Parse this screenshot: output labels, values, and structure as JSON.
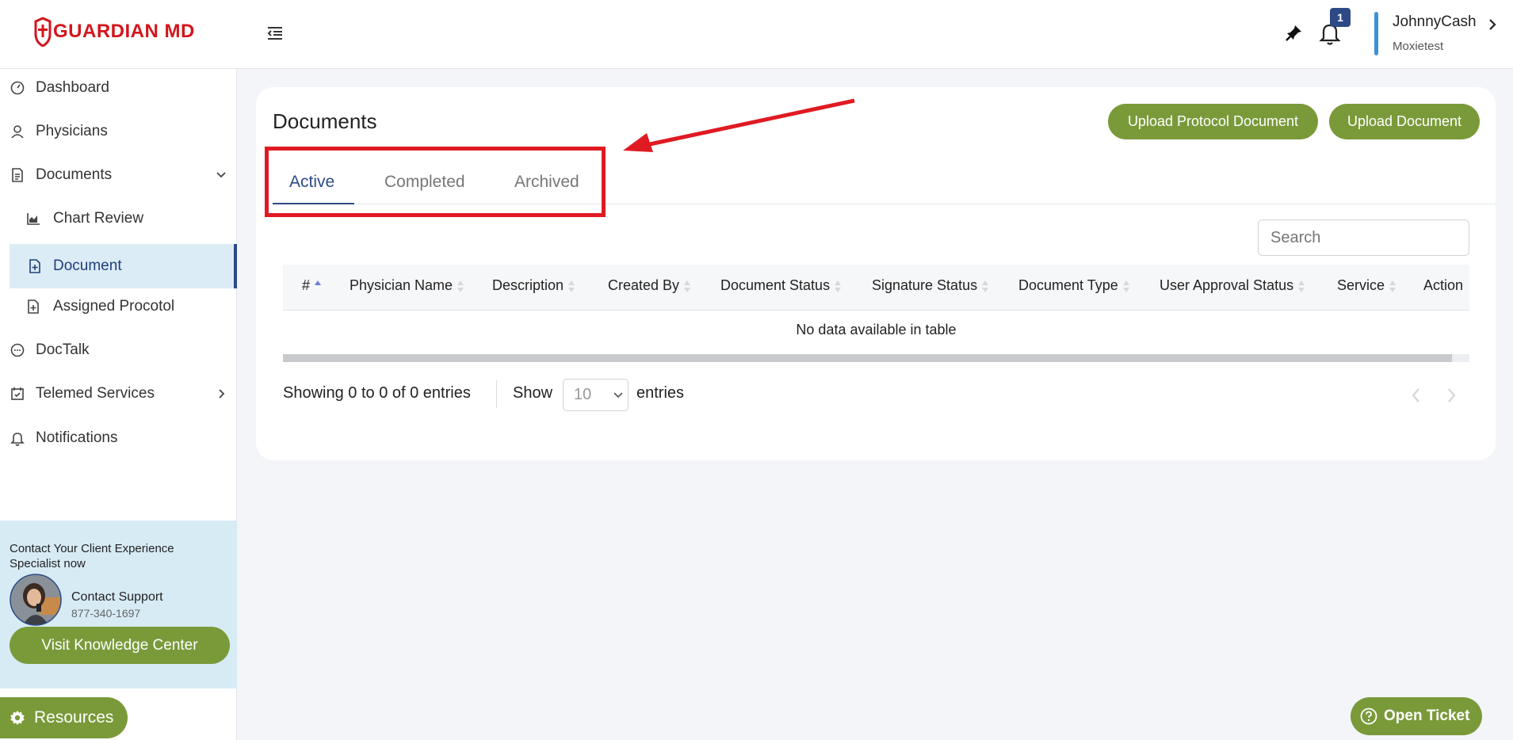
{
  "header": {
    "logo_text": "GUARDIAN MD",
    "notification_count": "1",
    "user_name": "JohnnyCash",
    "user_org": "Moxietest"
  },
  "sidebar": {
    "items": [
      {
        "label": "Dashboard",
        "icon": "dashboard-icon"
      },
      {
        "label": "Physicians",
        "icon": "user-icon"
      },
      {
        "label": "Documents",
        "icon": "document-icon"
      },
      {
        "label": "Chart Review",
        "icon": "chart-icon"
      },
      {
        "label": "Document",
        "icon": "file-plus-icon"
      },
      {
        "label": "Assigned Procotol",
        "icon": "file-plus-icon"
      },
      {
        "label": "DocTalk",
        "icon": "chat-icon"
      },
      {
        "label": "Telemed Services",
        "icon": "calendar-check-icon"
      },
      {
        "label": "Notifications",
        "icon": "bell-icon"
      }
    ],
    "support": {
      "title": "Contact Your Client Experience Specialist now",
      "name": "Contact Support",
      "phone": "877-340-1697",
      "knowledge_button": "Visit Knowledge Center"
    },
    "resources_button": "Resources"
  },
  "main": {
    "title": "Documents",
    "upload_protocol_button": "Upload Protocol Document",
    "upload_button": "Upload Document",
    "tabs": [
      {
        "label": "Active",
        "active": true
      },
      {
        "label": "Completed",
        "active": false
      },
      {
        "label": "Archived",
        "active": false
      }
    ],
    "search_placeholder": "Search",
    "table": {
      "columns": [
        "#",
        "Physician Name",
        "Description",
        "Created By",
        "Document Status",
        "Signature Status",
        "Document Type",
        "User Approval Status",
        "Service",
        "Action"
      ],
      "empty_message": "No data available in table"
    },
    "footer": {
      "showing": "Showing 0 to 0 of 0 entries",
      "show_label": "Show",
      "page_size": "10",
      "entries_label": "entries"
    }
  },
  "open_ticket_button": "Open Ticket",
  "colors": {
    "brand_red": "#d3151c",
    "accent_green": "#7a9a3a",
    "navy": "#2d4a86",
    "annotation_red": "#e01a22"
  }
}
